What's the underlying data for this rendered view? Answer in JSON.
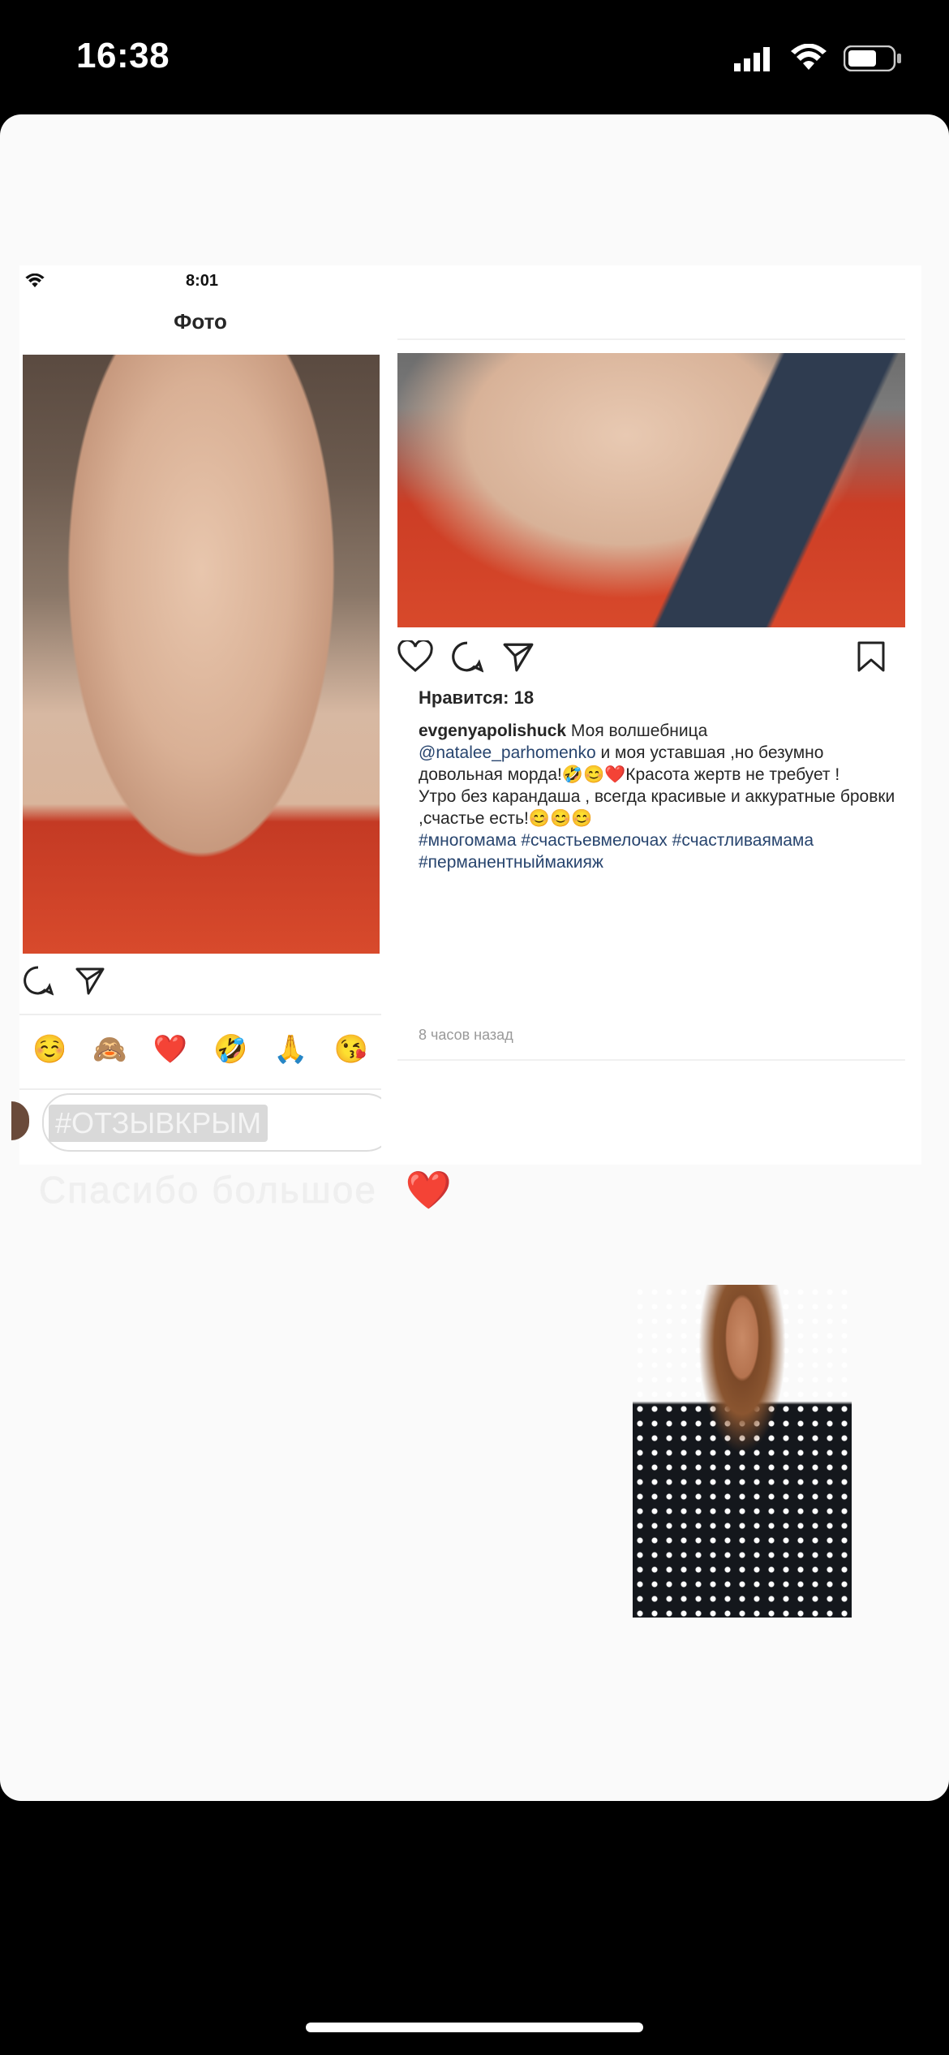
{
  "status_bar": {
    "time": "16:38"
  },
  "left_screenshot": {
    "status_time": "8:01",
    "header_title": "Фото",
    "emoji_row": [
      "☺️",
      "🙈",
      "❤️",
      "🤣",
      "🙏",
      "😘"
    ],
    "hashtag_sticker": "#ОТЗЫВКРЫМ"
  },
  "right_screenshot": {
    "likes": "Нравится: 18",
    "username": "evgenyapolishuck",
    "caption_line1": "Моя волшебница",
    "mention": "@natalee_parhomenko",
    "caption_line2": " и моя уставшая ,но безумно довольная морда!🤣😊❤️Красота жертв не требует !",
    "caption_line3": "Утро без карандаша , всегда красивые и аккуратные бровки ,счастье есть!😊😊😊",
    "hashtags": "#многомама #счастьевмелочах #счастливаямама #перманентныймакияж",
    "time_ago": "8 часов назад"
  },
  "story_caption": "Спасибо большое",
  "story_caption_emoji": "❤️",
  "colors": {
    "accent_link": "#27446e",
    "jacket_red": "#d8492b",
    "background": "#000000"
  }
}
